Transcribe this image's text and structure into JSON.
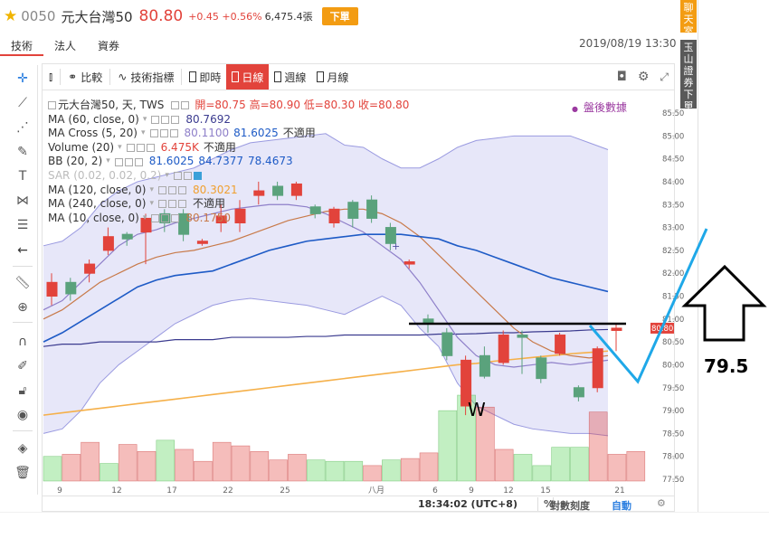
{
  "header": {
    "star_icon": "star-icon",
    "code": "0050",
    "name": "元大台灣50",
    "price": "80.80",
    "change": "+0.45 +0.56%",
    "volume": "6,475.4張",
    "order_label": "下單"
  },
  "tabs": [
    {
      "label": "技術",
      "active": true
    },
    {
      "label": "法人",
      "active": false
    },
    {
      "label": "資券",
      "active": false
    }
  ],
  "datetime": "2019/08/19 13:30",
  "side": {
    "chat": "聊天室",
    "broker": "玉山證券下單"
  },
  "toolbar": {
    "compare": "比較",
    "indicators": "技術指標",
    "periods": [
      "即時",
      "日線",
      "週線",
      "月線"
    ],
    "active_period": "日線"
  },
  "legend": {
    "title": "元大台灣50, 天, TWS",
    "ohlc": "開=80.75  高=80.90  低=80.30  收=80.80",
    "rows": [
      {
        "name": "MA (60, close, 0)",
        "values": [
          "80.7692"
        ],
        "colors": [
          "#3b3b8f"
        ]
      },
      {
        "name": "MA Cross (5, 20)",
        "values": [
          "80.1100",
          "81.6025",
          "不適用"
        ],
        "colors": [
          "#8e7fc9",
          "#1e5bc6",
          "#333333"
        ]
      },
      {
        "name": "Volume (20)",
        "values": [
          "6.475K",
          "不適用"
        ],
        "colors": [
          "#e2433b",
          "#333333"
        ]
      },
      {
        "name": "BB (20, 2)",
        "values": [
          "81.6025",
          "84.7377",
          "78.4673"
        ],
        "colors": [
          "#1e5bc6",
          "#1e5bc6",
          "#1e5bc6"
        ]
      },
      {
        "name": "SAR (0.02, 0.02, 0.2)",
        "values": [],
        "colors": [],
        "dim": true
      },
      {
        "name": "MA (120, close, 0)",
        "values": [
          "80.3021"
        ],
        "colors": [
          "#f0a030"
        ]
      },
      {
        "name": "MA (240, close, 0)",
        "values": [
          "不適用"
        ],
        "colors": [
          "#333333"
        ]
      },
      {
        "name": "MA (10, close, 0)",
        "values": [
          "80.1750"
        ],
        "colors": [
          "#c87a4a"
        ]
      }
    ]
  },
  "postmarket": "盤後數據",
  "y_ticks": [
    "85.50",
    "85.00",
    "84.50",
    "84.00",
    "83.50",
    "83.00",
    "82.50",
    "82.00",
    "81.50",
    "81.00",
    "80.50",
    "80.00",
    "79.50",
    "79.00",
    "78.50",
    "78.00",
    "77.50"
  ],
  "price_tag": "80.80",
  "x_ticks": [
    "9",
    "12",
    "17",
    "22",
    "25",
    "八月",
    "6",
    "9",
    "12",
    "15",
    "21"
  ],
  "timebar": {
    "clock": "18:34:02 (UTC+8)",
    "percent": "%",
    "log": "對數刻度",
    "auto": "自動"
  },
  "annotations": {
    "w_label": "W",
    "target_value": "79.5"
  },
  "colors": {
    "up": "#e2433b",
    "down": "#5aa27c",
    "accent": "#e2433b",
    "ma60": "#3b3b8f",
    "ma20": "#1e5bc6",
    "ma5": "#8e7fc9",
    "ma10": "#c87a4a",
    "ma120": "#f5b04a",
    "annotation": "#1fa8e8"
  },
  "chart_data": {
    "type": "candlestick",
    "ylim": [
      77.5,
      85.5
    ],
    "candles": [
      {
        "o": 81.5,
        "c": 81.8,
        "h": 82.0,
        "l": 81.3
      },
      {
        "o": 81.8,
        "c": 81.55,
        "h": 81.9,
        "l": 81.4
      },
      {
        "o": 82.0,
        "c": 82.2,
        "h": 82.3,
        "l": 81.8
      },
      {
        "o": 82.5,
        "c": 82.8,
        "h": 83.0,
        "l": 82.4
      },
      {
        "o": 82.85,
        "c": 82.75,
        "h": 82.9,
        "l": 82.6
      },
      {
        "o": 82.9,
        "c": 83.2,
        "h": 83.3,
        "l": 82.2
      },
      {
        "o": 83.3,
        "c": 83.1,
        "h": 83.4,
        "l": 82.9
      },
      {
        "o": 83.3,
        "c": 82.85,
        "h": 83.4,
        "l": 82.7
      },
      {
        "o": 82.65,
        "c": 82.7,
        "h": 82.75,
        "l": 82.6
      },
      {
        "o": 83.1,
        "c": 83.25,
        "h": 83.5,
        "l": 82.9
      },
      {
        "o": 83.1,
        "c": 83.4,
        "h": 83.6,
        "l": 82.9
      },
      {
        "o": 83.7,
        "c": 83.8,
        "h": 84.0,
        "l": 83.5
      },
      {
        "o": 83.9,
        "c": 83.7,
        "h": 84.0,
        "l": 83.6
      },
      {
        "o": 83.7,
        "c": 83.95,
        "h": 84.0,
        "l": 83.6
      },
      {
        "o": 83.45,
        "c": 83.3,
        "h": 83.5,
        "l": 83.2
      },
      {
        "o": 83.1,
        "c": 83.4,
        "h": 83.45,
        "l": 83.0
      },
      {
        "o": 83.55,
        "c": 83.2,
        "h": 83.6,
        "l": 83.0
      },
      {
        "o": 83.6,
        "c": 83.2,
        "h": 83.7,
        "l": 83.1
      },
      {
        "o": 83.0,
        "c": 82.65,
        "h": 83.1,
        "l": 82.5
      },
      {
        "o": 82.2,
        "c": 82.25,
        "h": 82.3,
        "l": 82.1
      },
      {
        "o": 81.0,
        "c": 80.9,
        "h": 81.1,
        "l": 80.7
      },
      {
        "o": 80.7,
        "c": 80.2,
        "h": 80.8,
        "l": 80.1
      },
      {
        "o": 79.1,
        "c": 80.1,
        "h": 80.2,
        "l": 78.9
      },
      {
        "o": 80.2,
        "c": 79.75,
        "h": 80.4,
        "l": 79.7
      },
      {
        "o": 80.05,
        "c": 80.65,
        "h": 80.75,
        "l": 80.0
      },
      {
        "o": 80.65,
        "c": 80.6,
        "h": 80.75,
        "l": 79.8
      },
      {
        "o": 80.15,
        "c": 79.7,
        "h": 80.2,
        "l": 79.6
      },
      {
        "o": 80.25,
        "c": 80.65,
        "h": 80.7,
        "l": 80.2
      },
      {
        "o": 79.5,
        "c": 79.3,
        "h": 79.55,
        "l": 79.2
      },
      {
        "o": 79.5,
        "c": 80.35,
        "h": 80.4,
        "l": 79.4
      },
      {
        "o": 80.75,
        "c": 80.8,
        "h": 80.9,
        "l": 80.3
      }
    ],
    "volume": [
      {
        "v": 0.35,
        "up": false
      },
      {
        "v": 0.38,
        "up": true
      },
      {
        "v": 0.55,
        "up": true
      },
      {
        "v": 0.25,
        "up": false
      },
      {
        "v": 0.52,
        "up": true
      },
      {
        "v": 0.42,
        "up": true
      },
      {
        "v": 0.58,
        "up": false
      },
      {
        "v": 0.45,
        "up": true
      },
      {
        "v": 0.28,
        "up": true
      },
      {
        "v": 0.55,
        "up": true
      },
      {
        "v": 0.5,
        "up": true
      },
      {
        "v": 0.42,
        "up": true
      },
      {
        "v": 0.3,
        "up": true
      },
      {
        "v": 0.38,
        "up": true
      },
      {
        "v": 0.3,
        "up": false
      },
      {
        "v": 0.28,
        "up": false
      },
      {
        "v": 0.28,
        "up": false
      },
      {
        "v": 0.22,
        "up": true
      },
      {
        "v": 0.3,
        "up": false
      },
      {
        "v": 0.32,
        "up": true
      },
      {
        "v": 0.4,
        "up": true
      },
      {
        "v": 1.0,
        "up": false
      },
      {
        "v": 1.22,
        "up": false
      },
      {
        "v": 1.05,
        "up": true
      },
      {
        "v": 0.45,
        "up": true
      },
      {
        "v": 0.38,
        "up": false
      },
      {
        "v": 0.22,
        "up": false
      },
      {
        "v": 0.48,
        "up": false
      },
      {
        "v": 0.48,
        "up": false
      },
      {
        "v": 0.98,
        "up": true
      },
      {
        "v": 0.38,
        "up": true
      },
      {
        "v": 0.42,
        "up": true
      }
    ],
    "bb_upper": [
      82.6,
      82.7,
      83.0,
      83.5,
      83.8,
      84.0,
      84.1,
      84.2,
      84.3,
      84.5,
      84.7,
      84.85,
      84.9,
      84.95,
      85.0,
      85.05,
      84.8,
      84.75,
      84.5,
      84.3,
      84.3,
      84.5,
      84.75,
      84.9,
      84.95,
      85.0,
      85.0,
      85.0,
      85.0,
      84.85,
      84.7
    ],
    "bb_lower": [
      78.5,
      78.6,
      79.0,
      79.6,
      80.0,
      80.3,
      80.6,
      80.9,
      81.1,
      81.3,
      81.4,
      81.45,
      81.4,
      81.35,
      81.3,
      81.2,
      81.1,
      81.3,
      81.5,
      81.3,
      80.8,
      80.4,
      79.6,
      79.1,
      78.9,
      78.7,
      78.6,
      78.55,
      78.5,
      78.5,
      78.45
    ],
    "ma20": [
      80.5,
      80.7,
      80.95,
      81.2,
      81.45,
      81.7,
      81.85,
      81.95,
      82.0,
      82.05,
      82.2,
      82.35,
      82.5,
      82.6,
      82.7,
      82.75,
      82.8,
      82.85,
      82.85,
      82.85,
      82.8,
      82.75,
      82.6,
      82.5,
      82.35,
      82.2,
      82.05,
      81.9,
      81.8,
      81.7,
      81.6
    ],
    "ma5": [
      81.2,
      81.4,
      81.8,
      82.2,
      82.6,
      82.85,
      82.95,
      83.1,
      83.2,
      83.3,
      83.4,
      83.45,
      83.5,
      83.5,
      83.45,
      83.3,
      83.1,
      82.9,
      82.6,
      82.3,
      81.8,
      81.2,
      80.6,
      80.2,
      80.0,
      79.95,
      80.0,
      80.05,
      80.0,
      80.05,
      80.1
    ],
    "ma10": [
      81.0,
      81.2,
      81.5,
      81.8,
      82.0,
      82.2,
      82.35,
      82.45,
      82.5,
      82.6,
      82.7,
      82.85,
      83.0,
      83.15,
      83.25,
      83.35,
      83.4,
      83.4,
      83.3,
      83.1,
      82.8,
      82.4,
      82.0,
      81.6,
      81.2,
      80.8,
      80.5,
      80.3,
      80.2,
      80.15,
      80.2
    ],
    "ma60": [
      80.4,
      80.45,
      80.45,
      80.5,
      80.5,
      80.5,
      80.5,
      80.55,
      80.55,
      80.55,
      80.6,
      80.6,
      80.6,
      80.6,
      80.62,
      80.62,
      80.65,
      80.65,
      80.65,
      80.65,
      80.65,
      80.67,
      80.67,
      80.68,
      80.7,
      80.7,
      80.72,
      80.73,
      80.74,
      80.76,
      80.77
    ],
    "ma120": [
      78.9,
      78.95,
      79.0,
      79.05,
      79.1,
      79.15,
      79.2,
      79.25,
      79.3,
      79.35,
      79.4,
      79.45,
      79.5,
      79.55,
      79.6,
      79.65,
      79.7,
      79.75,
      79.8,
      79.85,
      79.9,
      79.95,
      80.0,
      80.03,
      80.08,
      80.12,
      80.16,
      80.2,
      80.24,
      80.27,
      80.3
    ]
  }
}
